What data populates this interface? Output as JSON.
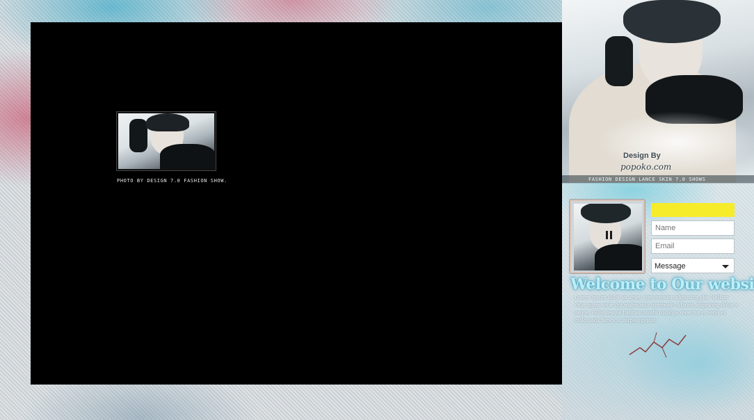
{
  "main": {
    "thumbnail": {
      "caption": "PHOTO BY DESIGN 7.0 FASHION SHOW."
    }
  },
  "hero": {
    "design_by": "Design By",
    "brand": "popoko.com",
    "strip_text": "FASHION DESIGN LANCE SKIN 7.0 SHOWS"
  },
  "contact": {
    "name_placeholder": "Name",
    "email_placeholder": "Email",
    "message_option": "Message"
  },
  "welcome": {
    "title": "Welcome to Our website",
    "body": "Lorem ipsum dolor sit amet, consectetuer adipiscing elit. Nullam vitae quam vitae dui malesuada commodo. Mauris adipiscing dolor a neque. Pellentesque habitant morbi tristique senectus et netus et malesuada fames ac turpis egestas."
  },
  "colors": {
    "stage_bg": "#000000",
    "yellow_bar": "#f7ec2a",
    "welcome_text": "#bfeef8"
  },
  "icons": {
    "pause": "pause-icon",
    "dropdown": "chevron-down-icon"
  }
}
